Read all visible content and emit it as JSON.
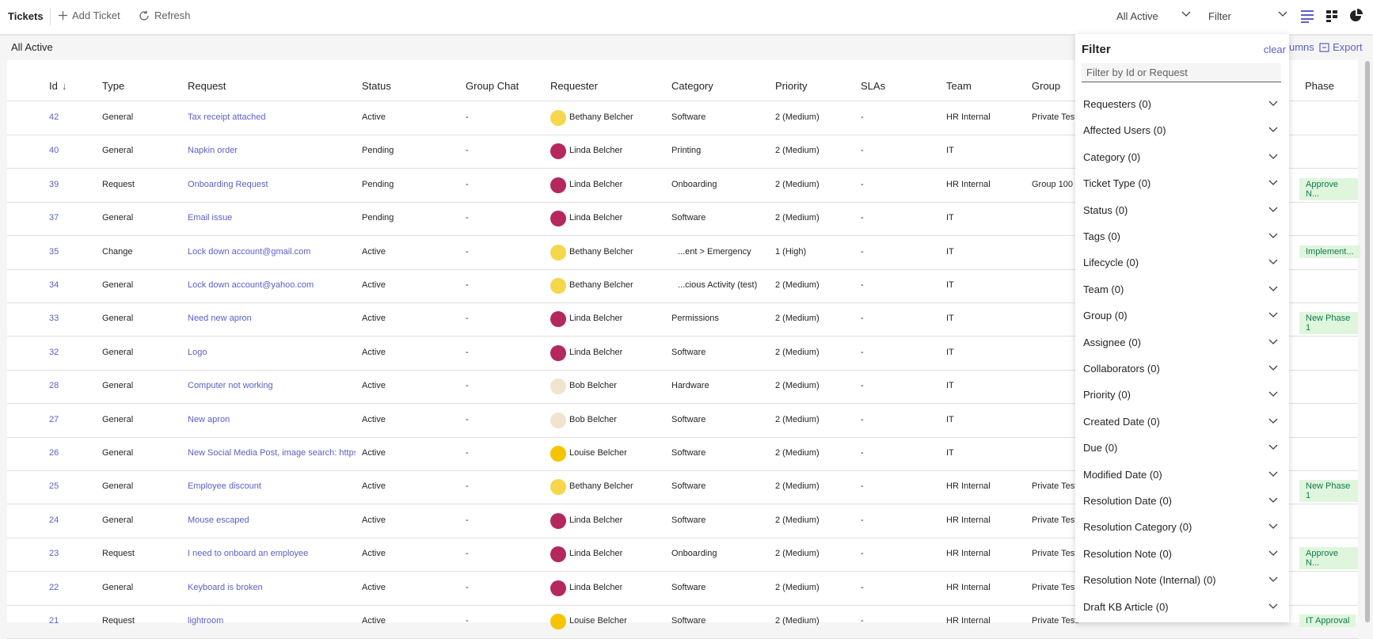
{
  "topbar": {
    "title": "Tickets",
    "add_label": "Add Ticket",
    "refresh_label": "Refresh",
    "view_select": "All Active",
    "filter_select": "Filter"
  },
  "subbar": {
    "view_name": "All Active",
    "columns_label": "umns",
    "export_label": "Export"
  },
  "table": {
    "headers": [
      "Id",
      "Type",
      "Request",
      "Status",
      "Group Chat",
      "Requester",
      "Category",
      "Priority",
      "SLAs",
      "Team",
      "Group",
      "Phase"
    ],
    "sort_indicator": "↓",
    "rows": [
      {
        "id": "42",
        "type": "General",
        "request": "Tax receipt attached",
        "status": "Active",
        "chat": "-",
        "requester": "Bethany Belcher",
        "avatar": "bethany",
        "category": "Software",
        "priority": "2 (Medium)",
        "slas": "-",
        "team": "HR Internal",
        "group": "Private Testi",
        "phase": ""
      },
      {
        "id": "40",
        "type": "General",
        "request": "Napkin order",
        "status": "Pending",
        "chat": "-",
        "requester": "Linda Belcher",
        "avatar": "linda",
        "category": "Printing",
        "priority": "2 (Medium)",
        "slas": "-",
        "team": "IT",
        "group": "",
        "phase": ""
      },
      {
        "id": "39",
        "type": "Request",
        "request": "Onboarding Request",
        "status": "Pending",
        "chat": "-",
        "requester": "Linda Belcher",
        "avatar": "linda",
        "category": "Onboarding",
        "priority": "2 (Medium)",
        "slas": "-",
        "team": "HR Internal",
        "group": "Group 100",
        "phase": "Approve N..."
      },
      {
        "id": "37",
        "type": "General",
        "request": "Email issue",
        "status": "Pending",
        "chat": "-",
        "requester": "Linda Belcher",
        "avatar": "linda",
        "category": "Software",
        "priority": "2 (Medium)",
        "slas": "-",
        "team": "IT",
        "group": "",
        "phase": ""
      },
      {
        "id": "35",
        "type": "Change",
        "request": "Lock down account@gmail.com",
        "status": "Active",
        "chat": "-",
        "requester": "Bethany Belcher",
        "avatar": "bethany",
        "category": "...ent > Emergency",
        "priority": "1 (High)",
        "slas": "-",
        "team": "IT",
        "group": "",
        "phase": "Implement..."
      },
      {
        "id": "34",
        "type": "General",
        "request": "Lock down account@yahoo.com",
        "status": "Active",
        "chat": "-",
        "requester": "Bethany Belcher",
        "avatar": "bethany",
        "category": "...cious Activity (test)",
        "priority": "2 (Medium)",
        "slas": "-",
        "team": "IT",
        "group": "",
        "phase": ""
      },
      {
        "id": "33",
        "type": "General",
        "request": "Need new apron",
        "status": "Active",
        "chat": "-",
        "requester": "Linda Belcher",
        "avatar": "linda",
        "category": "Permissions",
        "priority": "2 (Medium)",
        "slas": "-",
        "team": "IT",
        "group": "",
        "phase": "New Phase 1"
      },
      {
        "id": "32",
        "type": "General",
        "request": "Logo",
        "status": "Active",
        "chat": "-",
        "requester": "Linda Belcher",
        "avatar": "linda",
        "category": "Software",
        "priority": "2 (Medium)",
        "slas": "-",
        "team": "IT",
        "group": "",
        "phase": ""
      },
      {
        "id": "28",
        "type": "General",
        "request": "Computer not working",
        "status": "Active",
        "chat": "-",
        "requester": "Bob Belcher",
        "avatar": "bob",
        "category": "Hardware",
        "priority": "2 (Medium)",
        "slas": "-",
        "team": "IT",
        "group": "",
        "phase": ""
      },
      {
        "id": "27",
        "type": "General",
        "request": "New apron",
        "status": "Active",
        "chat": "-",
        "requester": "Bob Belcher",
        "avatar": "bob",
        "category": "Software",
        "priority": "2 (Medium)",
        "slas": "-",
        "team": "IT",
        "group": "",
        "phase": ""
      },
      {
        "id": "26",
        "type": "General",
        "request": "New Social Media Post, image search: https;",
        "status": "Active",
        "chat": "-",
        "requester": "Louise Belcher",
        "avatar": "louise",
        "category": "Software",
        "priority": "2 (Medium)",
        "slas": "-",
        "team": "IT",
        "group": "",
        "phase": ""
      },
      {
        "id": "25",
        "type": "General",
        "request": "Employee discount",
        "status": "Active",
        "chat": "-",
        "requester": "Bethany Belcher",
        "avatar": "bethany",
        "category": "Software",
        "priority": "2 (Medium)",
        "slas": "-",
        "team": "HR Internal",
        "group": "Private Testi",
        "phase": "New Phase 1"
      },
      {
        "id": "24",
        "type": "General",
        "request": "Mouse escaped",
        "status": "Active",
        "chat": "-",
        "requester": "Linda Belcher",
        "avatar": "linda",
        "category": "Software",
        "priority": "2 (Medium)",
        "slas": "-",
        "team": "HR Internal",
        "group": "Private Testi",
        "phase": ""
      },
      {
        "id": "23",
        "type": "Request",
        "request": "I need to onboard an employee",
        "status": "Active",
        "chat": "-",
        "requester": "Linda Belcher",
        "avatar": "linda",
        "category": "Onboarding",
        "priority": "2 (Medium)",
        "slas": "-",
        "team": "HR Internal",
        "group": "Private Testi",
        "phase": "Approve N..."
      },
      {
        "id": "22",
        "type": "General",
        "request": "Keyboard is broken",
        "status": "Active",
        "chat": "-",
        "requester": "Linda Belcher",
        "avatar": "linda",
        "category": "Software",
        "priority": "2 (Medium)",
        "slas": "-",
        "team": "HR Internal",
        "group": "Private Testi",
        "phase": ""
      },
      {
        "id": "21",
        "type": "Request",
        "request": "lightroom",
        "status": "Active",
        "chat": "-",
        "requester": "Louise Belcher",
        "avatar": "louise",
        "category": "Software",
        "priority": "2 (Medium)",
        "slas": "-",
        "team": "HR Internal",
        "group": "Private Testi",
        "phase": "IT Approval"
      }
    ]
  },
  "filter_panel": {
    "title": "Filter",
    "clear_label": "clear",
    "search_placeholder": "Filter by Id or Request",
    "items": [
      "Requesters (0)",
      "Affected Users (0)",
      "Category (0)",
      "Ticket Type (0)",
      "Status (0)",
      "Tags (0)",
      "Lifecycle (0)",
      "Team (0)",
      "Group (0)",
      "Assignee (0)",
      "Collaborators (0)",
      "Priority (0)",
      "Created Date (0)",
      "Due (0)",
      "Modified Date (0)",
      "Resolution Date (0)",
      "Resolution Category (0)",
      "Resolution Note (0)",
      "Resolution Note (Internal) (0)",
      "Draft KB Article (0)"
    ]
  },
  "colors": {
    "accent": "#5b5fc7",
    "phase_bg": "#dff6dd",
    "phase_fg": "#0e7a4d"
  }
}
